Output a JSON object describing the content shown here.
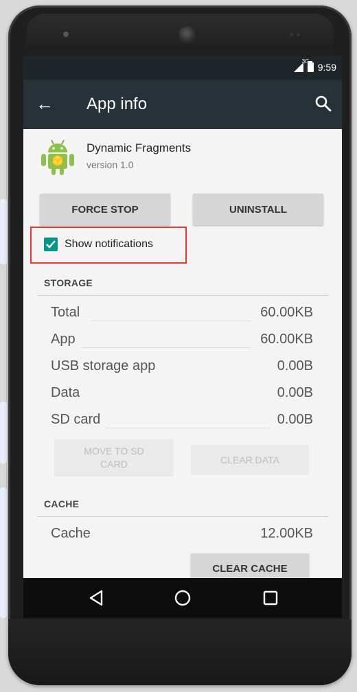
{
  "statusbar": {
    "network": "3G",
    "time": "9:59"
  },
  "appbar": {
    "title": "App info",
    "back_icon": "arrow-left-icon",
    "search_icon": "search-icon"
  },
  "app": {
    "name": "Dynamic Fragments",
    "version": "version 1.0",
    "icon": "android-robot-icon"
  },
  "buttons": {
    "force_stop": "FORCE STOP",
    "uninstall": "UNINSTALL"
  },
  "notifications": {
    "label": "Show notifications",
    "checked": true,
    "highlight_color": "#e53935"
  },
  "storage": {
    "title": "STORAGE",
    "rows": [
      {
        "label": "Total",
        "value": "60.00KB"
      },
      {
        "label": "App",
        "value": "60.00KB"
      },
      {
        "label": "USB storage app",
        "value": "0.00B"
      },
      {
        "label": "Data",
        "value": "0.00B"
      },
      {
        "label": "SD card",
        "value": "0.00B"
      }
    ],
    "move_button": "MOVE TO SD CARD",
    "clear_data_button": "CLEAR DATA"
  },
  "cache": {
    "title": "CACHE",
    "row": {
      "label": "Cache",
      "value": "12.00KB"
    },
    "clear_cache_button": "CLEAR CACHE"
  },
  "navbar": {
    "back": "nav-back-icon",
    "home": "nav-home-icon",
    "recents": "nav-recents-icon"
  },
  "colors": {
    "appbar": "#263238",
    "statusbar": "#1e2629",
    "accent": "#009688"
  }
}
